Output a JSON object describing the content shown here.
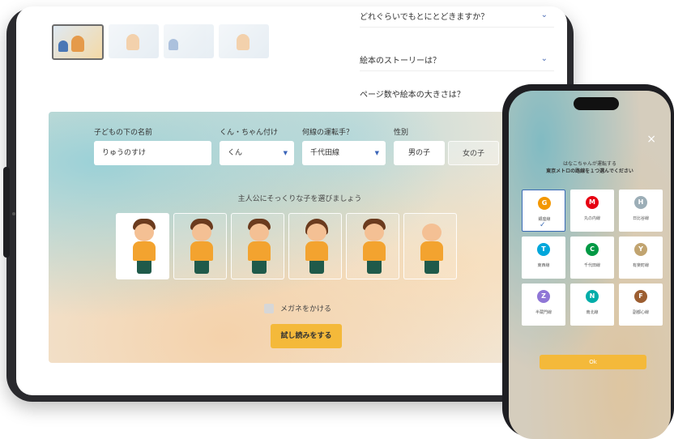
{
  "tablet": {
    "faq": [
      {
        "label": "どれぐらいでもとにとどきますか？"
      },
      {
        "label": "絵本のストーリーは？"
      },
      {
        "label": "ページ数や絵本の大きさは？"
      }
    ],
    "form": {
      "name_label": "子どもの下の名前",
      "name_value": "りゅうのすけ",
      "suffix_label": "くん・ちゃん付け",
      "suffix_value": "くん",
      "line_label": "何線の運転手？",
      "line_value": "千代田線",
      "gender_label": "性別",
      "gender_male": "男の子",
      "gender_female": "女の子",
      "prompt": "主人公にそっくりな子を選びましょう",
      "glasses_label": "メガネをかける",
      "try_button": "試し読みをする"
    }
  },
  "phone": {
    "title_line1": "はなこちゃんが運転する",
    "title_line2": "東京メトロの路線を１つ選んでください",
    "close_icon": "×",
    "ok_label": "Ok",
    "lines": [
      {
        "letter": "G",
        "name": "銀座線",
        "color": "#f39700",
        "selected": true
      },
      {
        "letter": "M",
        "name": "丸の内線",
        "color": "#e60012",
        "selected": false
      },
      {
        "letter": "H",
        "name": "日比谷線",
        "color": "#9caeb7",
        "selected": false
      },
      {
        "letter": "T",
        "name": "東西線",
        "color": "#00a7db",
        "selected": false
      },
      {
        "letter": "C",
        "name": "千代田線",
        "color": "#009944",
        "selected": false
      },
      {
        "letter": "Y",
        "name": "有楽町線",
        "color": "#c1a470",
        "selected": false
      },
      {
        "letter": "Z",
        "name": "半蔵門線",
        "color": "#8f76d6",
        "selected": false
      },
      {
        "letter": "N",
        "name": "南北線",
        "color": "#00ada9",
        "selected": false
      },
      {
        "letter": "F",
        "name": "副都心線",
        "color": "#9c5e31",
        "selected": false
      }
    ]
  }
}
